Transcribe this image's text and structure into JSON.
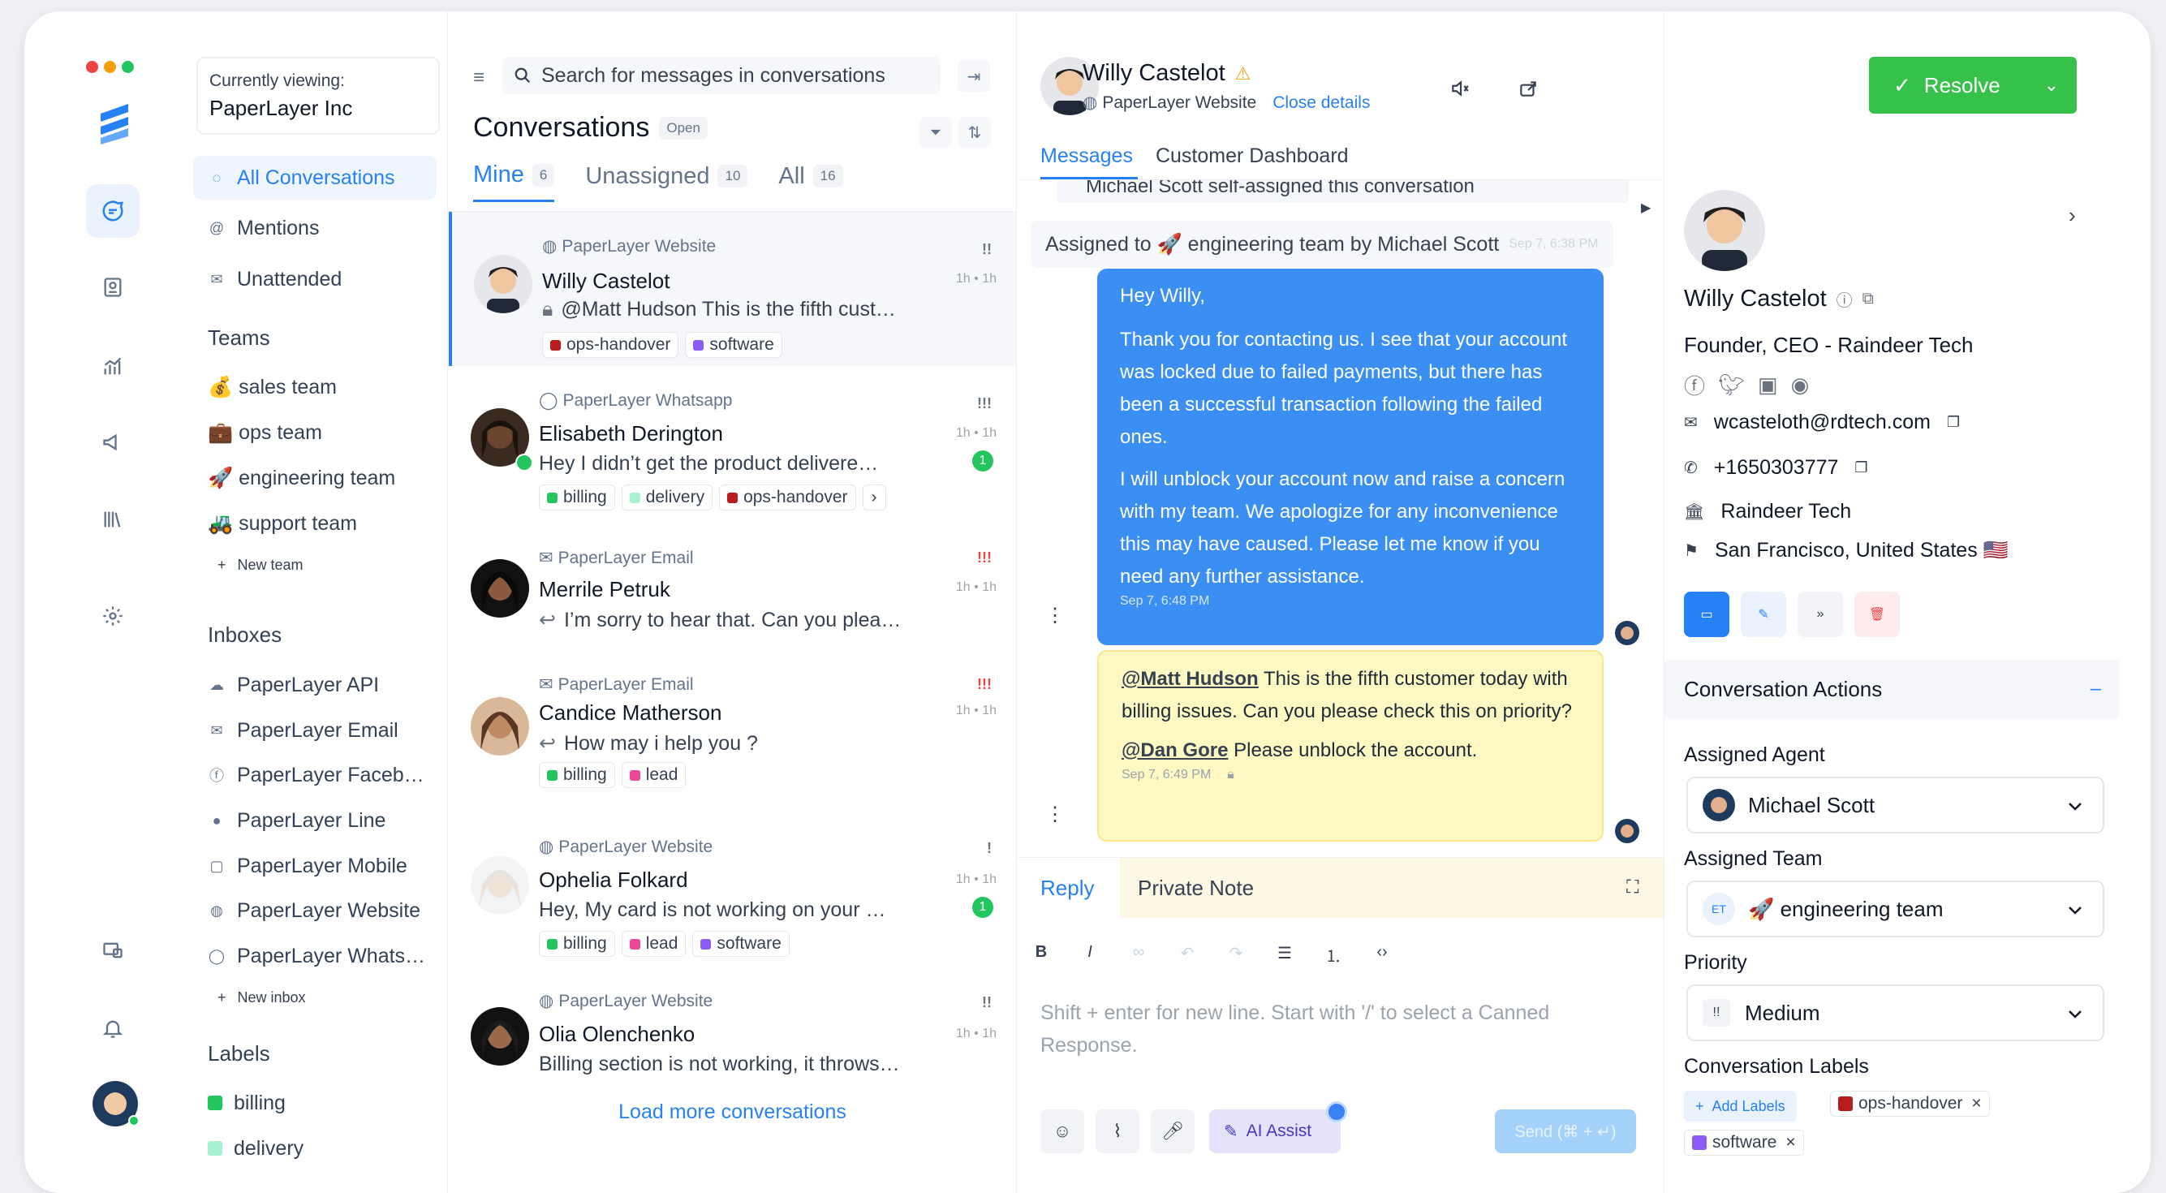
{
  "sidebar": {
    "viewing_label": "Currently viewing:",
    "org": "PaperLayer Inc",
    "menu": [
      "All Conversations",
      "Mentions",
      "Unattended"
    ],
    "teams_heading": "Teams",
    "teams": [
      "💰 sales team",
      "💼 ops team",
      "🚀 engineering team",
      "🚜 support team"
    ],
    "new_team": "New team",
    "inboxes_heading": "Inboxes",
    "inboxes": [
      "PaperLayer API",
      "PaperLayer Email",
      "PaperLayer Faceb…",
      "PaperLayer Line",
      "PaperLayer Mobile",
      "PaperLayer Website",
      "PaperLayer Whats…"
    ],
    "new_inbox": "New inbox",
    "labels_heading": "Labels",
    "labels": [
      {
        "name": "billing",
        "color": "#22c55e"
      },
      {
        "name": "delivery",
        "color": "#a7f3d0"
      }
    ]
  },
  "conversations": {
    "search_placeholder": "Search for messages in conversations",
    "title": "Conversations",
    "status": "Open",
    "tabs": [
      {
        "label": "Mine",
        "count": "6"
      },
      {
        "label": "Unassigned",
        "count": "10"
      },
      {
        "label": "All",
        "count": "16"
      }
    ],
    "items": [
      {
        "inbox": "PaperLayer Website",
        "name": "Willy Castelot",
        "message": "@Matt Hudson This is the fifth cust…",
        "time": "1h • 1h",
        "priority": "!!",
        "labels": [
          "ops-handover",
          "software"
        ]
      },
      {
        "inbox": "PaperLayer Whatsapp",
        "name": "Elisabeth Derington",
        "message": "Hey I didn’t get the product delivere…",
        "time": "1h • 1h",
        "priority": "!!!",
        "unread": "1",
        "labels": [
          "billing",
          "delivery",
          "ops-handover"
        ]
      },
      {
        "inbox": "PaperLayer Email",
        "name": "Merrile Petruk",
        "message": "I’m sorry to hear that. Can you plea…",
        "time": "1h • 1h",
        "priority": "!!!",
        "labels": []
      },
      {
        "inbox": "PaperLayer Email",
        "name": "Candice Matherson",
        "message": "How may i help you ?",
        "time": "1h • 1h",
        "priority": "!!!",
        "labels": [
          "billing",
          "lead"
        ]
      },
      {
        "inbox": "PaperLayer Website",
        "name": "Ophelia Folkard",
        "message": "Hey, My card is not working on your …",
        "time": "1h • 1h",
        "priority": "!",
        "unread": "1",
        "labels": [
          "billing",
          "lead",
          "software"
        ]
      },
      {
        "inbox": "PaperLayer Website",
        "name": "Olia Olenchenko",
        "message": "Billing section is not working, it throws…",
        "time": "1h • 1h",
        "priority": "!!",
        "labels": []
      }
    ],
    "load_more": "Load more conversations"
  },
  "label_colors": {
    "ops-handover": "#b91c1c",
    "software": "#8b5cf6",
    "billing": "#22c55e",
    "delivery": "#a7f3d0",
    "lead": "#ec4899"
  },
  "chat": {
    "contact_name": "Willy Castelot",
    "inbox": "PaperLayer Website",
    "close_details": "Close details",
    "resolve": "Resolve",
    "tabs": [
      "Messages",
      "Customer Dashboard"
    ],
    "activity_top": "Michael Scott self-assigned this conversation",
    "activity": "Assigned to 🚀 engineering team by Michael Scott",
    "activity_time": "Sep 7, 6:38 PM",
    "msg1_greeting": "Hey Willy,",
    "msg1_p1": "Thank you for contacting us. I see that your account was locked due to failed payments, but there has been a successful transaction following the failed ones.",
    "msg1_p2": "I will unblock your account now and raise a concern with my team. We apologize for any inconvenience this may have caused. Please let me know if you need any further assistance.",
    "msg1_time": "Sep 7, 6:48 PM",
    "note_mention1": "@Matt Hudson",
    "note_text1": " This is the fifth customer today with billing issues. Can you please check this on priority?",
    "note_mention2": "@Dan Gore",
    "note_text2": " Please unblock the account.",
    "note_time": "Sep 7, 6:49 PM",
    "reply_tab": "Reply",
    "note_tab": "Private Note",
    "editor_placeholder": "Shift + enter for new line. Start with '/' to select a Canned Response.",
    "ai_assist": "AI Assist",
    "send": "Send (⌘ + ↵)"
  },
  "contact": {
    "name": "Willy Castelot",
    "title": "Founder, CEO - Raindeer Tech",
    "email": "wcasteloth@rdtech.com",
    "phone": "+1650303777",
    "company": "Raindeer Tech",
    "location": "San Francisco, United States 🇺🇸"
  },
  "actions": {
    "heading": "Conversation Actions",
    "agent_label": "Assigned Agent",
    "agent": "Michael Scott",
    "team_label": "Assigned Team",
    "team_badge": "ET",
    "team": "🚀 engineering team",
    "priority_label": "Priority",
    "priority_icon": "!!",
    "priority": "Medium",
    "labels_label": "Conversation Labels",
    "add_labels": "Add Labels",
    "labels": [
      "ops-handover",
      "software"
    ]
  }
}
